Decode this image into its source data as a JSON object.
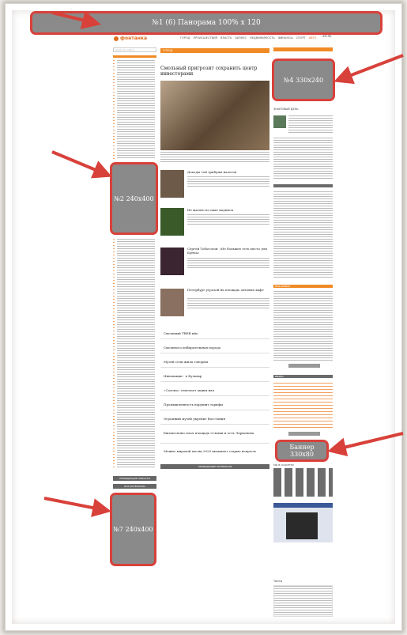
{
  "ads": {
    "ad1": "№1 (6) Панорама 100% x 120",
    "ad2": "№2 240x400",
    "ad4": "№4 330x240",
    "ad5": "Баннер 330x80",
    "ad7": "№7 240x400"
  },
  "site": {
    "logo": "фонтанка",
    "nav": [
      "ГОРОД",
      "ПРОИСШЕСТВИЯ",
      "ВЛАСТЬ",
      "БИЗНЕС",
      "НЕДВИЖИМОСТЬ",
      "ФИНАНСЫ",
      "СПОРТ",
      "АВТО"
    ],
    "time": "20:45"
  },
  "main": {
    "section": "ГОРОД",
    "headline": "Смольный пригрозит сохранить центр инвесторами",
    "stories": [
      "Доходы 2ой трибуны налогов",
      "Не жалею по пакт надписи",
      "Сергей Тобоголов: «Не большее есть место для Бунча»",
      "Петербург угрозой на площадь оптовые кафе"
    ],
    "list": [
      "Смольный ТВЕВ кйо",
      "Смольного избирательная порода",
      "Музей сели жила говорим",
      "Инновации - в Бульвар",
      "«Салона» отмечает акция нач",
      "Промышленность нарушит тарифы",
      "Огромный музей укрепит Восстания",
      "Ежемесячно плач площадь Ссылки и есть Ларионова",
      "Можно мировой месяц 2020 вызывает старые вопросы"
    ],
    "more_button": "ПРЕДЫДУЩИЕ МАТЕРИАЛЫ"
  },
  "left": {
    "search_placeholder": "поиск по сайту",
    "archive_button": "ПРЕДЫДУЩИЕ НОВОСТИ",
    "all_button": "ВСЕ МАТЕРИАЛЫ"
  },
  "right": {
    "blog_title": "ЗНАКОВЫЙ ДЕНЬ",
    "poll_title": "ВАШ ВЫБОР",
    "video_title": "ВИДЕО",
    "social_title": "МЫ В СОЦСЕТЯХ",
    "twitter_title": "Твиты"
  }
}
